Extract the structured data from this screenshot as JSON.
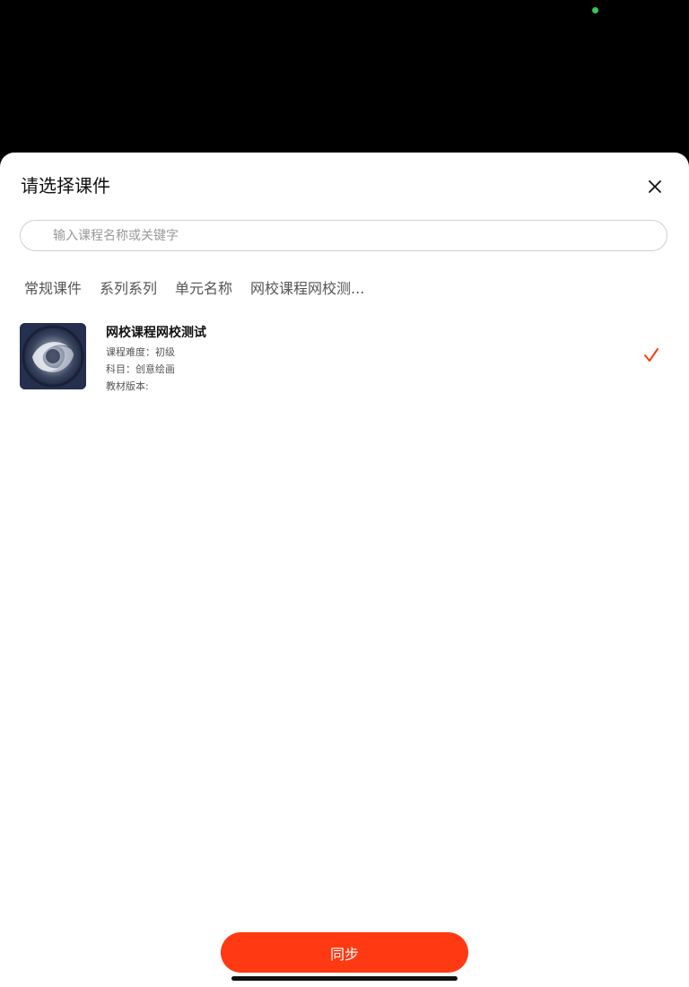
{
  "sheet": {
    "title": "请选择课件"
  },
  "search": {
    "placeholder": "输入课程名称或关键字",
    "value": ""
  },
  "breadcrumb": [
    "常规课件",
    "系列系列",
    "单元名称",
    "网校课程网校测..."
  ],
  "item": {
    "title": "网校课程网校测试",
    "difficulty": "课程难度：初级",
    "subject": "科目：创意绘画",
    "edition": "教材版本:",
    "selected": true
  },
  "actions": {
    "sync_label": "同步"
  },
  "icons": {
    "close": "close-icon",
    "check": "checkmark-icon"
  },
  "colors": {
    "accent": "#ff3a12",
    "status_dot": "#34c759"
  }
}
